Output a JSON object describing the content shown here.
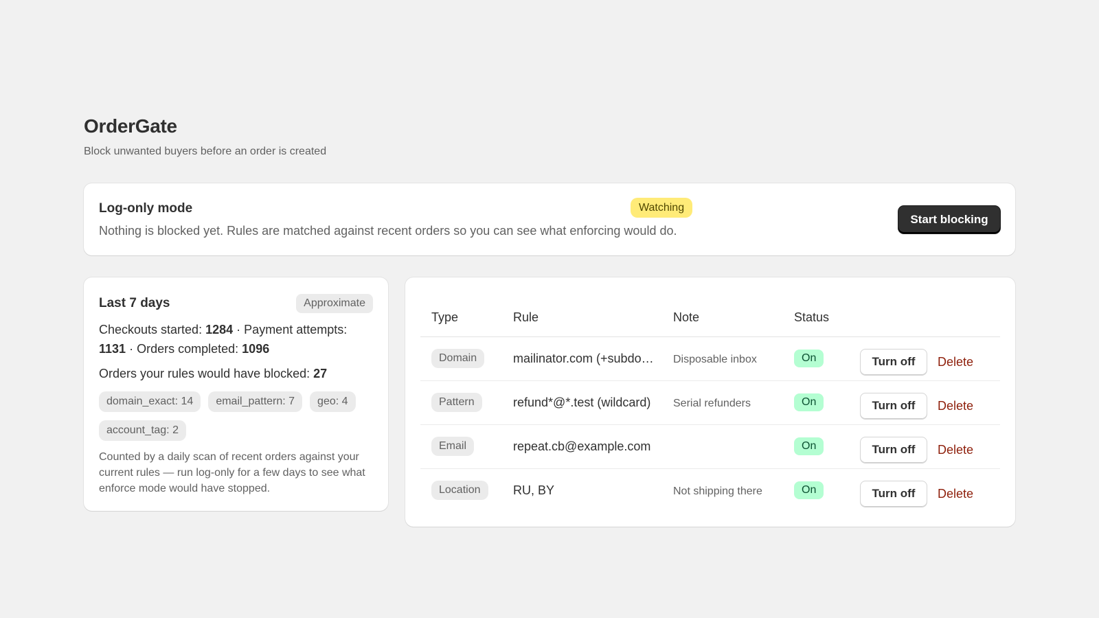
{
  "app": {
    "title": "OrderGate",
    "subtitle": "Block unwanted buyers before an order is created"
  },
  "mode": {
    "title": "Log-only mode",
    "badge": "Watching",
    "description": "Nothing is blocked yet. Rules are matched against recent orders so you can see what enforcing would do.",
    "button_label": "Start blocking"
  },
  "stats": {
    "title": "Last 7 days",
    "badge": "Approximate",
    "checkouts_label": "Checkouts started:",
    "checkouts_value": "1284",
    "payments_label": "Payment attempts:",
    "payments_value": "1131",
    "orders_label": "Orders completed:",
    "orders_value": "1096",
    "separator": "·",
    "blocked_label": "Orders your rules would have blocked:",
    "blocked_value": "27",
    "tags": [
      "domain_exact: 14",
      "email_pattern: 7",
      "geo: 4",
      "account_tag: 2"
    ],
    "note": "Counted by a daily scan of recent orders against your current rules — run log-only for a few days to see what enforce mode would have stopped."
  },
  "rules": {
    "headers": {
      "type": "Type",
      "rule": "Rule",
      "note": "Note",
      "status": "Status"
    },
    "rows": [
      {
        "type": "Domain",
        "rule": "mailinator.com (+subdomains)",
        "note": "Disposable inbox",
        "status": "On",
        "toggle_label": "Turn off",
        "delete_label": "Delete"
      },
      {
        "type": "Pattern",
        "rule": "refund*@*.test (wildcard)",
        "note": "Serial refunders",
        "status": "On",
        "toggle_label": "Turn off",
        "delete_label": "Delete"
      },
      {
        "type": "Email",
        "rule": "repeat.cb@example.com",
        "note": "",
        "status": "On",
        "toggle_label": "Turn off",
        "delete_label": "Delete"
      },
      {
        "type": "Location",
        "rule": "RU, BY",
        "note": "Not shipping there",
        "status": "On",
        "toggle_label": "Turn off",
        "delete_label": "Delete"
      }
    ]
  }
}
